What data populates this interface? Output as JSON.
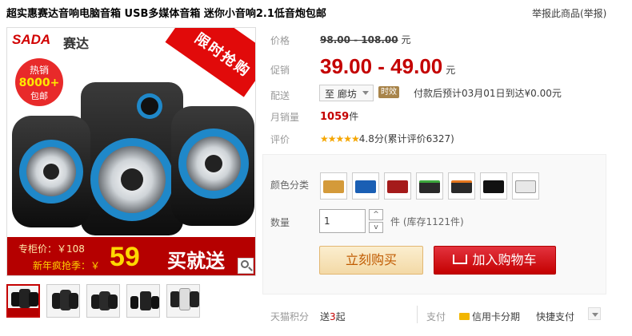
{
  "product": {
    "title": "超实惠赛达音响电脑音箱 USB多媒体音箱 迷你小音响2.1低音炮包邮",
    "report_link": "举报此商品(举报)"
  },
  "image": {
    "brand_logo": "SADA",
    "brand_cn": "赛达",
    "promo_corner": "限时抢购",
    "hot_sale": "热销",
    "hot_count": "8000+",
    "free_ship": "包邮",
    "counter_price_label": "专柜价：￥108",
    "new_year_label": "新年疯抢季：￥",
    "big_price": "59",
    "buy_send": "买就送"
  },
  "labels": {
    "price": "价格",
    "promo": "促销",
    "delivery": "配送",
    "monthly_sales": "月销量",
    "rating": "评价",
    "color": "颜色分类",
    "quantity": "数量",
    "points": "天猫积分"
  },
  "price": {
    "original": "98.00 - 108.00",
    "original_unit": "元",
    "promo": "39.00 - 49.00",
    "promo_unit": "元"
  },
  "delivery": {
    "selected": "至 廊坊",
    "time_badge": "时效",
    "info": "付款后预计03月01日到达¥0.00元"
  },
  "sales": {
    "count": "1059",
    "unit": "件"
  },
  "rating": {
    "stars": "★★★★★",
    "score": "4.8分(累计评价6327)"
  },
  "colors": [
    "gold",
    "blue",
    "red",
    "green",
    "orange",
    "black",
    "white"
  ],
  "quantity": {
    "value": "1",
    "stock": "件 (库存1121件)",
    "up": "^",
    "down": "v"
  },
  "actions": {
    "buy_now": "立刻购买",
    "add_cart": "加入购物车"
  },
  "footer": {
    "points_value_prefix": "送",
    "points_value": "3",
    "points_value_suffix": "起",
    "pay_label": "支付",
    "credit_card": "信用卡分期",
    "quick_pay": "快捷支付"
  }
}
